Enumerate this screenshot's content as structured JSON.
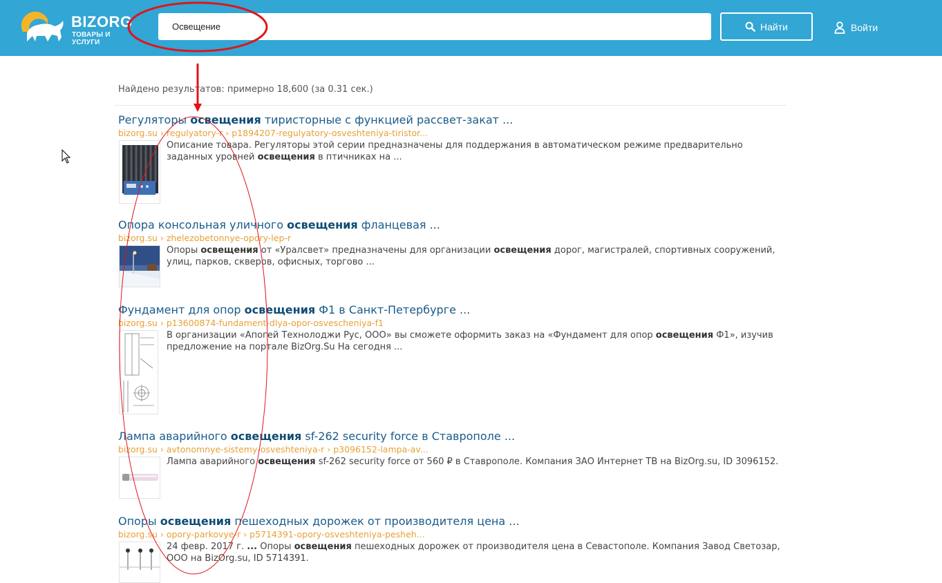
{
  "header": {
    "logo_name": "BIZORG",
    "logo_tagline": "ТОВАРЫ И УСЛУГИ",
    "search_value": "Освещение",
    "search_button_label": "Найти",
    "login_label": "Войти"
  },
  "results_count": "Найдено результатов: примерно 18,600 (за 0.31 сек.)",
  "results": [
    {
      "title_pre": "Регуляторы ",
      "title_bold": "освещения",
      "title_post": " тиристорные с функцией рассвет-закат ...",
      "url": "bizorg.su › regulyatory-r › p1894207-regulyatory-osveshteniya-tiristor...",
      "snippet_pre": "Описание товара. Регуляторы этой серии предназначены для поддержания в автоматическом режиме предварительно заданных уровней ",
      "snippet_bold1": "освещения",
      "snippet_mid": " в птичниках на ...",
      "snippet_bold2": "",
      "snippet_post": ""
    },
    {
      "title_pre": "Опора консольная уличного ",
      "title_bold": "освещения",
      "title_post": " фланцевая ...",
      "url": "bizorg.su › zhelezobetonnye-opory-lep-r",
      "snippet_pre": "Опоры ",
      "snippet_bold1": "освещения",
      "snippet_mid": " от «Уралсвет» предназначены для организации ",
      "snippet_bold2": "освещения",
      "snippet_post": " дорог, магистралей, спортивных сооружений, улиц, парков, скверов, офисных, торгово ..."
    },
    {
      "title_pre": "Фундамент для опор ",
      "title_bold": "освещения",
      "title_post": " Ф1 в Санкт-Петербурге ...",
      "url": "bizorg.su › p13600874-fundament-dlya-opor-osvescheniya-f1",
      "snippet_pre": "В организации «Апогей Технолоджи Рус, ООО» вы сможете оформить заказ на «Фундамент для опор ",
      "snippet_bold1": "освещения",
      "snippet_mid": " Ф1», изучив предложение на портале BizOrg.Su На сегодня ...",
      "snippet_bold2": "",
      "snippet_post": ""
    },
    {
      "title_pre": "Лампа аварийного ",
      "title_bold": "освещения",
      "title_post": " sf-262 security force в Ставрополе ...",
      "url": "bizorg.su › avtonomnye-sistemy-osveshteniya-r › p3096152-lampa-av...",
      "snippet_pre": "Лампа аварийного ",
      "snippet_bold1": "освещения",
      "snippet_mid": " sf-262 security force от 560 ₽ в Ставрополе. Компания ЗАО Интернет ТВ на BizOrg.su, ID 3096152.",
      "snippet_bold2": "",
      "snippet_post": ""
    },
    {
      "title_pre": "Опоры ",
      "title_bold": "освещения",
      "title_post": " пешеходных дорожек от производителя цена ...",
      "url": "bizorg.su › opory-parkovye-r › p5714391-opory-osveshteniya-pesheh...",
      "snippet_pre": "24 февр. 2017 г. ",
      "snippet_bold1": "...",
      "snippet_mid": " Опоры ",
      "snippet_bold2": "освещения",
      "snippet_post": " пешеходных дорожек от производителя цена в Севастополе. Компания Завод Светозар, ООО на BizOrg.su, ID 5714391."
    }
  ],
  "colors": {
    "header_bg": "#32a6d4",
    "title_link": "#1a5b8a",
    "url_text": "#e8a036",
    "annotation": "#e0141a"
  },
  "icons": [
    "bison-logo-icon",
    "search-icon",
    "user-icon",
    "mouse-cursor-icon"
  ]
}
